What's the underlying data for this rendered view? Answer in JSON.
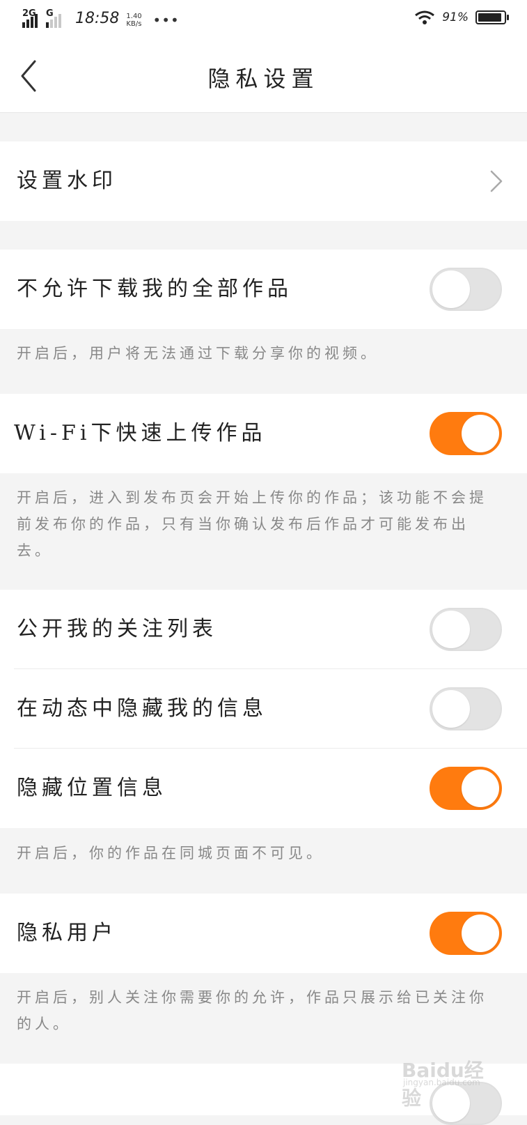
{
  "status_bar": {
    "signal_1": "2G",
    "signal_2": "G",
    "time": "18:58",
    "speed_value": "1.40",
    "speed_unit": "KB/s",
    "more": "•••",
    "wifi_icon": "wifi-icon",
    "battery_percent": "91%",
    "battery_level": 0.91
  },
  "nav": {
    "back_icon": "chevron-left-icon",
    "title": "隐私设置"
  },
  "rows": {
    "watermark": {
      "label": "设置水印",
      "icon": "chevron-right-icon"
    },
    "no_download": {
      "label": "不允许下载我的全部作品",
      "on": false
    },
    "no_download_desc": "开启后，用户将无法通过下载分享你的视频。",
    "wifi_upload": {
      "label": "Wi-Fi下快速上传作品",
      "on": true
    },
    "wifi_upload_desc": "开启后，进入到发布页会开始上传你的作品；该功能不会提前发布你的作品，只有当你确认发布后作品才可能发布出去。",
    "public_follow": {
      "label": "公开我的关注列表",
      "on": false
    },
    "hide_in_feed": {
      "label": "在动态中隐藏我的信息",
      "on": false
    },
    "hide_location": {
      "label": "隐藏位置信息",
      "on": true
    },
    "hide_location_desc": "开启后，你的作品在同城页面不可见。",
    "private_user": {
      "label": "隐私用户",
      "on": true
    },
    "private_user_desc": "开启后，别人关注你需要你的允许，作品只展示给已关注你的人。"
  },
  "watermark_overlay": {
    "text": "Baidu经验",
    "url": "jingyan.baidu.com"
  },
  "colors": {
    "accent": "#ff7b0f",
    "switch_off": "#e3e3e3",
    "background": "#f4f4f4",
    "desc_text": "#888888"
  }
}
